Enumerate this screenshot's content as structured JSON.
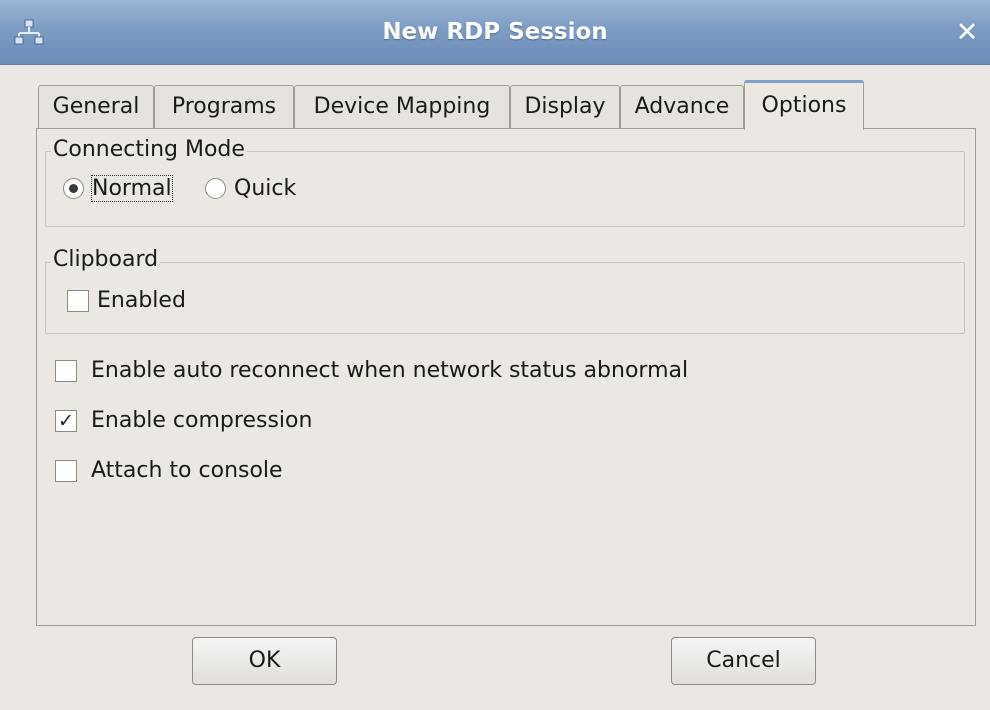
{
  "window": {
    "title": "New RDP Session",
    "icon": "network-icon",
    "close_glyph": "✕"
  },
  "tabs": [
    {
      "label": "General",
      "active": false
    },
    {
      "label": "Programs",
      "active": false
    },
    {
      "label": "Device Mapping",
      "active": false
    },
    {
      "label": "Display",
      "active": false
    },
    {
      "label": "Advance",
      "active": false
    },
    {
      "label": "Options",
      "active": true
    }
  ],
  "connecting_mode": {
    "label": "Connecting Mode",
    "options": [
      {
        "label": "Normal",
        "selected": true
      },
      {
        "label": "Quick",
        "selected": false
      }
    ]
  },
  "clipboard": {
    "label": "Clipboard",
    "enabled_label": "Enabled",
    "enabled_checked": false
  },
  "options": [
    {
      "label": "Enable auto reconnect when network status abnormal",
      "checked": false
    },
    {
      "label": "Enable compression",
      "checked": true
    },
    {
      "label": "Attach to console",
      "checked": false
    }
  ],
  "buttons": {
    "ok": "OK",
    "cancel": "Cancel"
  },
  "colors": {
    "titlebar": "#7d9cc3",
    "background": "#ebe8e4",
    "active_tab_accent": "#7fa0cb"
  }
}
